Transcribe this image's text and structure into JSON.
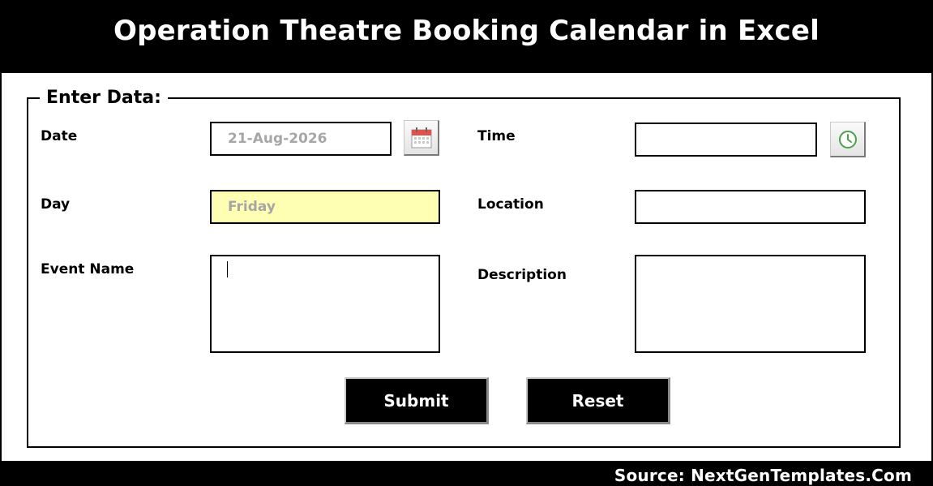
{
  "header": {
    "title": "Operation Theatre Booking Calendar in Excel"
  },
  "form": {
    "legend": "Enter Data:",
    "date": {
      "label": "Date",
      "value": "21-Aug-2026"
    },
    "time": {
      "label": "Time",
      "value": ""
    },
    "day": {
      "label": "Day",
      "value": "Friday"
    },
    "location": {
      "label": "Location",
      "value": ""
    },
    "event_name": {
      "label": "Event Name",
      "value": ""
    },
    "description": {
      "label": "Description",
      "value": ""
    },
    "submit_label": "Submit",
    "reset_label": "Reset"
  },
  "icons": {
    "date_picker": "calendar-icon",
    "time_picker": "clock-icon"
  },
  "colors": {
    "header_bg": "#000000",
    "button_bg": "#000000",
    "day_field_bg": "#ffffb3",
    "placeholder_text": "#a6a6a6",
    "calendar_accent": "#e0524a",
    "clock_accent": "#4aa14a"
  },
  "footer": {
    "source": "Source: NextGenTemplates.Com"
  }
}
